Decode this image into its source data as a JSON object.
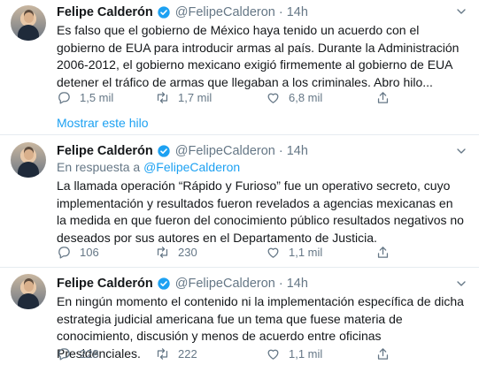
{
  "tweets": [
    {
      "name": "Felipe Calderón",
      "handle": "@FelipeCalderon · 14h",
      "reply_prefix": "",
      "reply_handle": "",
      "text": "Es falso que el gobierno de México haya tenido un acuerdo con el gobierno de EUA para introducir armas al país. Durante la Administración 2006-2012, el gobierno mexicano exigió firmemente al gobierno de EUA detener el tráfico de armas que llegaban a los criminales. Abro hilo...",
      "replies": "1,5 mil",
      "retweets": "1,7 mil",
      "likes": "6,8 mil",
      "show_thread": "Mostrar este hilo"
    },
    {
      "name": "Felipe Calderón",
      "handle": "@FelipeCalderon · 14h",
      "reply_prefix": "En respuesta a ",
      "reply_handle": "@FelipeCalderon",
      "text": "La llamada operación “Rápido y Furioso” fue un operativo secreto, cuyo implementación y resultados fueron revelados a agencias mexicanas en la medida en que fueron del conocimiento público resultados negativos no deseados por sus autores en el Departamento de Justicia.",
      "replies": "106",
      "retweets": "230",
      "likes": "1,1 mil"
    },
    {
      "name": "Felipe Calderón",
      "handle": "@FelipeCalderon · 14h",
      "text": "En ningún momento el contenido ni la implementación específica de dicha estrategia judicial americana fue un tema que fuese materia de conocimiento, discusión y menos de acuerdo  entre  oficinas Presidenciales.",
      "replies": "228",
      "retweets": "222",
      "likes": "1,1 mil"
    }
  ],
  "icons": {
    "verified": "verified-badge-icon",
    "caret": "chevron-down-icon",
    "reply": "reply-icon",
    "retweet": "retweet-icon",
    "like": "heart-icon",
    "share": "share-icon"
  },
  "colors": {
    "accent": "#1da1f2",
    "secondary_text": "#657786",
    "divider": "#e6ecf0"
  }
}
